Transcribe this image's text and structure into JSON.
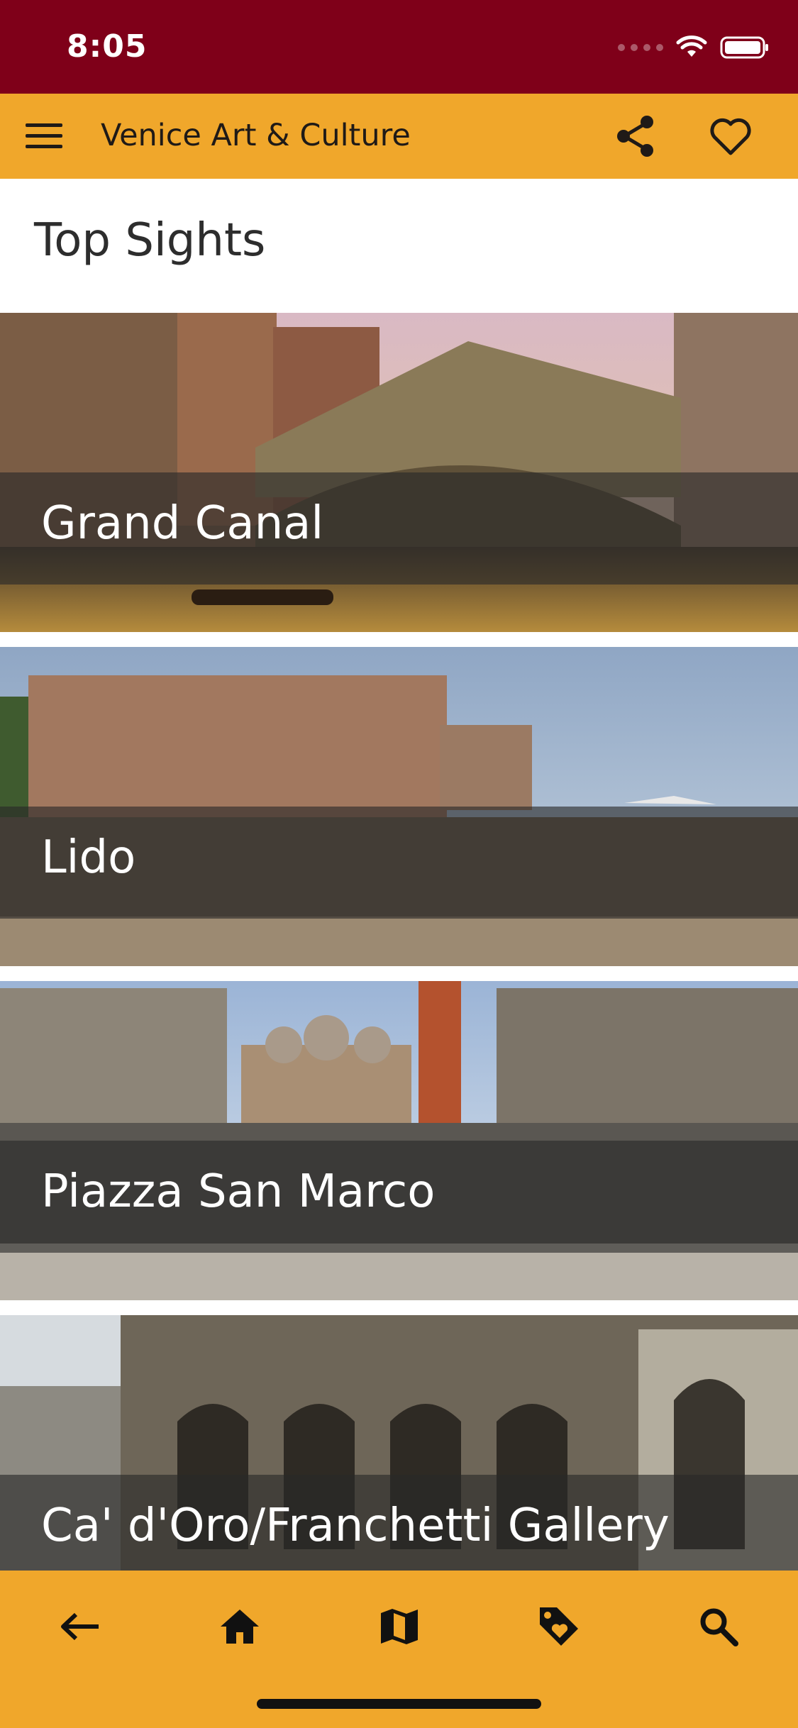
{
  "status_bar": {
    "time": "8:05",
    "background": "#7f0019",
    "icons": [
      "signal-icon",
      "wifi-icon",
      "battery-icon"
    ]
  },
  "app_bar": {
    "title": "Venice Art & Culture",
    "background": "#f0a72b",
    "icons": [
      "menu-icon",
      "share-icon",
      "heart-icon"
    ]
  },
  "section": {
    "title": "Top Sights"
  },
  "sights": [
    {
      "label": "Grand Canal"
    },
    {
      "label": "Lido"
    },
    {
      "label": "Piazza San Marco"
    },
    {
      "label": "Ca' d'Oro/Franchetti Gallery"
    }
  ],
  "bottom_nav": {
    "background": "#f0a72b",
    "icons": [
      "back-arrow-icon",
      "home-icon",
      "map-icon",
      "tag-icon",
      "search-icon"
    ]
  }
}
